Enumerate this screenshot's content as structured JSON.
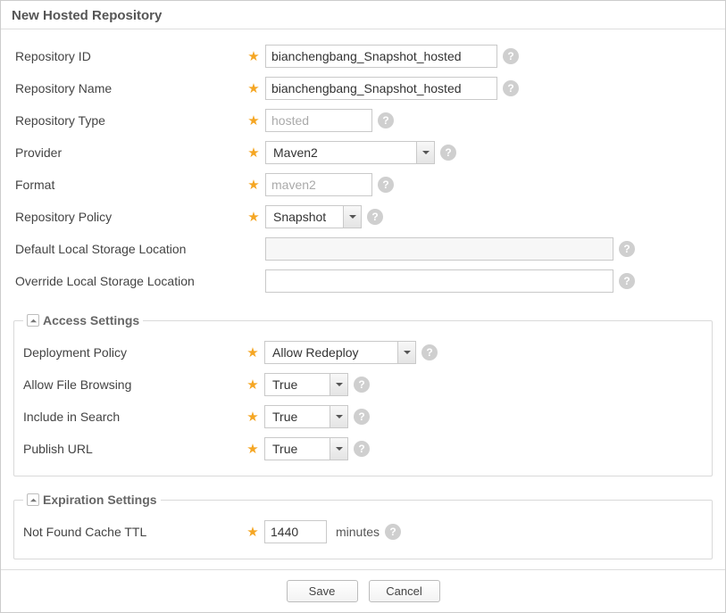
{
  "title": "New Hosted Repository",
  "fields": {
    "repo_id": {
      "label": "Repository ID",
      "required": true,
      "value": "bianchengbang_Snapshot_hosted"
    },
    "repo_name": {
      "label": "Repository Name",
      "required": true,
      "value": "bianchengbang_Snapshot_hosted"
    },
    "repo_type": {
      "label": "Repository Type",
      "required": true,
      "value": "hosted",
      "readonly": true
    },
    "provider": {
      "label": "Provider",
      "required": true,
      "value": "Maven2"
    },
    "format": {
      "label": "Format",
      "required": true,
      "value": "maven2",
      "readonly": true
    },
    "policy": {
      "label": "Repository Policy",
      "required": true,
      "value": "Snapshot"
    },
    "default_store": {
      "label": "Default Local Storage Location",
      "required": false,
      "value": ""
    },
    "override_store": {
      "label": "Override Local Storage Location",
      "required": false,
      "value": ""
    }
  },
  "access": {
    "legend": "Access Settings",
    "deploy_policy": {
      "label": "Deployment Policy",
      "required": true,
      "value": "Allow Redeploy"
    },
    "file_browse": {
      "label": "Allow File Browsing",
      "required": true,
      "value": "True"
    },
    "include_search": {
      "label": "Include in Search",
      "required": true,
      "value": "True"
    },
    "publish_url": {
      "label": "Publish URL",
      "required": true,
      "value": "True"
    }
  },
  "expiration": {
    "legend": "Expiration Settings",
    "nf_cache_ttl": {
      "label": "Not Found Cache TTL",
      "required": true,
      "value": "1440",
      "unit": "minutes"
    }
  },
  "buttons": {
    "save": "Save",
    "cancel": "Cancel"
  }
}
